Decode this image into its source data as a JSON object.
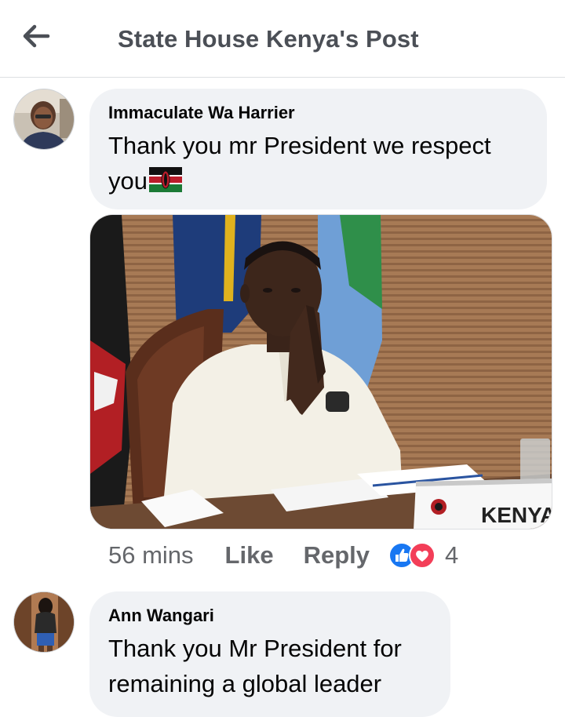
{
  "header": {
    "title": "State House Kenya's Post",
    "back_icon": "arrow-left-icon"
  },
  "comments": [
    {
      "author": "Immaculate Wa Harrier",
      "text_line1": "Thank you mr President we respect",
      "text_line2": "you",
      "emoji": "kenya-flag-icon",
      "time": "56 mins",
      "like_label": "Like",
      "reply_label": "Reply",
      "reactions": [
        "like-reaction-icon",
        "love-reaction-icon"
      ],
      "reaction_count": "4",
      "photo_label": "KENYA"
    },
    {
      "author": "Ann Wangari",
      "text_line1": "Thank you Mr President for",
      "text_line2": "remaining a global leader"
    }
  ],
  "colors": {
    "bubble": "#f0f2f5",
    "muted_text": "#65676b",
    "header_text": "#4b4f56",
    "like_blue": "#1877f2",
    "love_red": "#f33e58"
  }
}
